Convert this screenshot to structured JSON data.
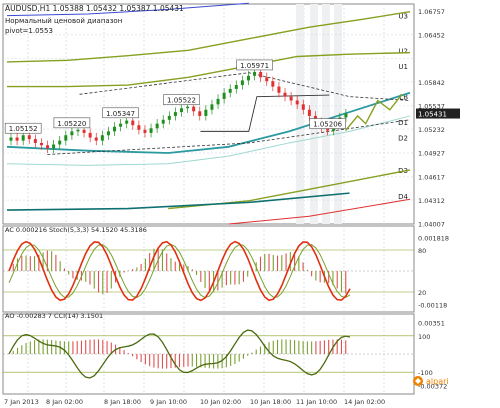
{
  "header": {
    "symbol_line": "AUDUSD,H1  1.05388 1.05432 1.05387 1.05431",
    "subtitle_line1": "Нормальный ценовой диапазон",
    "subtitle_line2": "pivot=1.0553"
  },
  "colors": {
    "background": "#ffffff",
    "border": "#8a8a8a",
    "grid": "#c9d4dc",
    "candle_up": "#1f8f1f",
    "candle_down": "#e03030",
    "channel_olive": "#86a020",
    "ma_teal": "#2a9aa0",
    "ma_dark_teal": "#0e7070",
    "ma_blue": "#3a4ad0",
    "band_light": "#9fd8d0",
    "stoch_main": "#e03010",
    "osc_hist_green": "#7aa030",
    "osc_hist_red": "#e05050",
    "price_label_bg": "#202020",
    "alpari_orange": "#f08000"
  },
  "levels": {
    "pivot_labels": [
      "U3",
      "U2",
      "U1",
      "LB",
      "D1",
      "D2",
      "D3",
      "D4"
    ]
  },
  "chart_data": [
    {
      "type": "candlestick",
      "panel": "price",
      "title": "AUDUSD,H1",
      "ylim": [
        1.04,
        1.0685
      ],
      "ytick_labels": [
        "1.06757",
        "1.06452",
        "1.05842",
        "1.05537",
        "1.05431",
        "1.05232",
        "1.04927",
        "1.04617",
        "1.04312",
        "1.04007"
      ],
      "current_price": "1.05431",
      "price_annotations": [
        {
          "label": "1.05152",
          "price": 1.0515
        },
        {
          "label": "1.05220",
          "price": 1.0522
        },
        {
          "label": "1.05347",
          "price": 1.0535
        },
        {
          "label": "1.05522",
          "price": 1.0552
        },
        {
          "label": "1.05971",
          "price": 1.0597
        },
        {
          "label": "1.05206",
          "price": 1.0521
        }
      ],
      "grid": true
    },
    {
      "type": "line",
      "panel": "oscillator-1",
      "label": "AC  0.000216  Stoch(5,3,3)  54.1520  45.3186",
      "ytick_labels": [
        "0.001818",
        "80",
        "20",
        "-0.00118"
      ]
    },
    {
      "type": "bar",
      "panel": "oscillator-2",
      "label": "AO  -0.00283 7  CCI(14)  3.1501",
      "ytick_labels": [
        "0.00351",
        "100",
        "-100",
        "-0.00372"
      ]
    }
  ],
  "x_axis": {
    "tick_labels": [
      "7 Jan 2013",
      "8 Jan 02:00",
      "8 Jan 18:00",
      "9 Jan 10:00",
      "10 Jan 02:00",
      "10 Jan 18:00",
      "11 Jan 10:00",
      "14 Jan 02:00"
    ]
  },
  "branding": {
    "logo_text": "alpari"
  }
}
